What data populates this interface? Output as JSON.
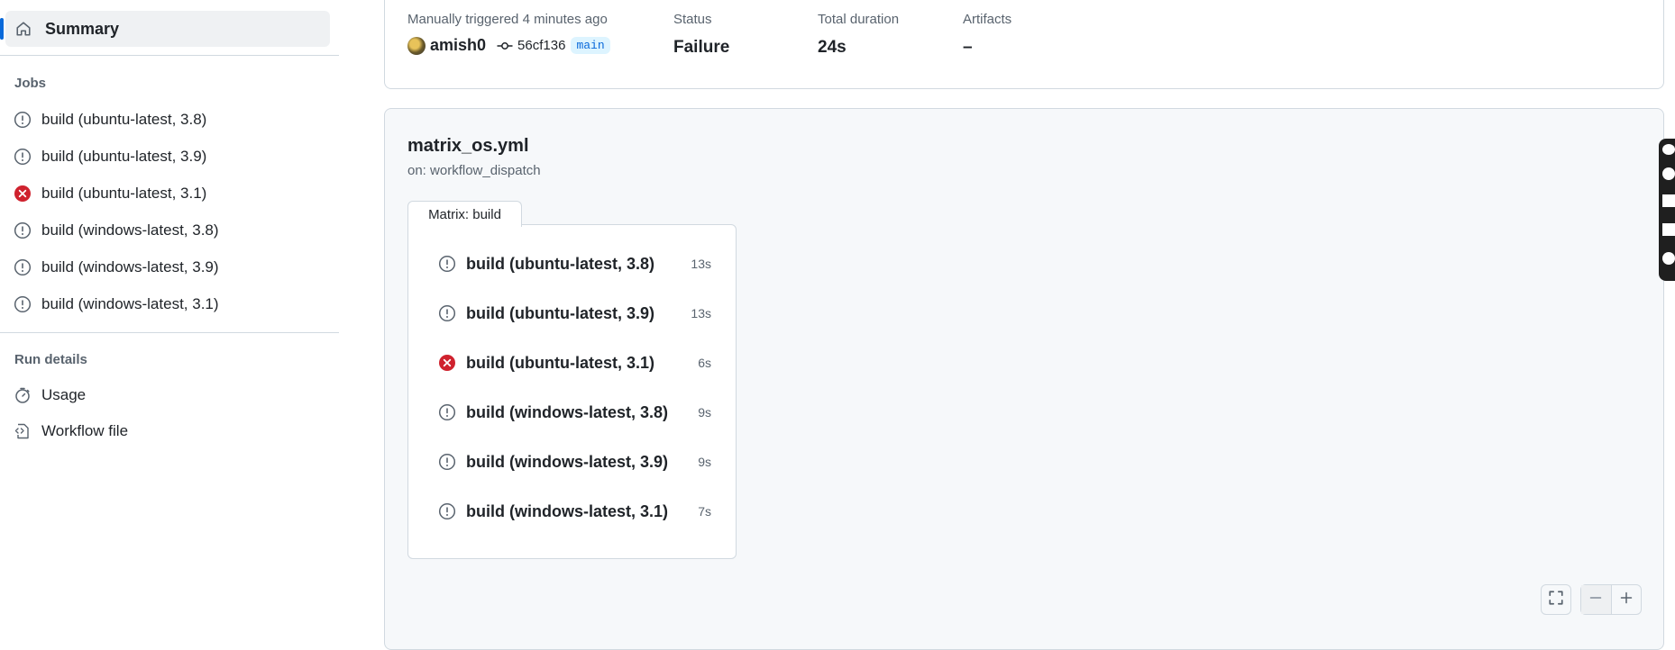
{
  "sidebar": {
    "summary_label": "Summary",
    "jobs_title": "Jobs",
    "jobs": [
      {
        "label": "build (ubuntu-latest, 3.8)",
        "status": "warning"
      },
      {
        "label": "build (ubuntu-latest, 3.9)",
        "status": "warning"
      },
      {
        "label": "build (ubuntu-latest, 3.1)",
        "status": "failure"
      },
      {
        "label": "build (windows-latest, 3.8)",
        "status": "warning"
      },
      {
        "label": "build (windows-latest, 3.9)",
        "status": "warning"
      },
      {
        "label": "build (windows-latest, 3.1)",
        "status": "warning"
      }
    ],
    "run_details_title": "Run details",
    "usage_label": "Usage",
    "workflow_file_label": "Workflow file"
  },
  "run": {
    "trigger_text": "Manually triggered 4 minutes ago",
    "actor": "amish0",
    "commit_sha": "56cf136",
    "branch": "main",
    "status_label": "Status",
    "status_value": "Failure",
    "duration_label": "Total duration",
    "duration_value": "24s",
    "artifacts_label": "Artifacts",
    "artifacts_value": "–"
  },
  "graph": {
    "workflow_name": "matrix_os.yml",
    "trigger": "on: workflow_dispatch",
    "matrix_label": "Matrix: build",
    "jobs": [
      {
        "label": "build (ubuntu-latest, 3.8)",
        "duration": "13s",
        "status": "warning"
      },
      {
        "label": "build (ubuntu-latest, 3.9)",
        "duration": "13s",
        "status": "warning"
      },
      {
        "label": "build (ubuntu-latest, 3.1)",
        "duration": "6s",
        "status": "failure"
      },
      {
        "label": "build (windows-latest, 3.8)",
        "duration": "9s",
        "status": "warning"
      },
      {
        "label": "build (windows-latest, 3.9)",
        "duration": "9s",
        "status": "warning"
      },
      {
        "label": "build (windows-latest, 3.1)",
        "duration": "7s",
        "status": "warning"
      }
    ]
  },
  "colors": {
    "failure": "#cf222e",
    "warning_icon": "#59636e",
    "accent": "#0969da"
  },
  "icons": {
    "summary": "home-icon",
    "warning": "alert-circle-icon",
    "failure": "x-circle-fill-icon",
    "usage": "stopwatch-icon",
    "workflow_file": "file-code-icon",
    "commit": "git-commit-icon",
    "fullscreen": "screen-full-icon",
    "zoom_out": "minus-icon",
    "zoom_in": "plus-icon"
  }
}
